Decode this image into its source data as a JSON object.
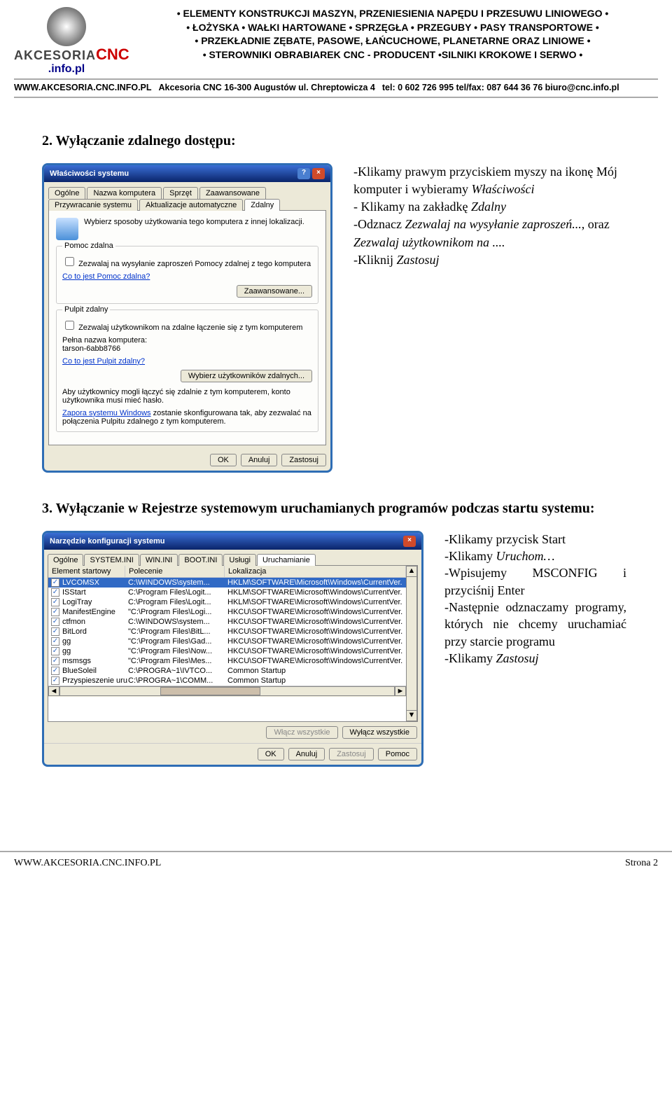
{
  "header": {
    "logo": {
      "akc": "AKCESORIA",
      "cnc": "CNC",
      "info": ".info.pl"
    },
    "lines": [
      "• ELEMENTY KONSTRUKCJI MASZYN, PRZENIESIENIA NAPĘDU I PRZESUWU LINIOWEGO •",
      "• ŁOŻYSKA • WAŁKI HARTOWANE • SPRZĘGŁA • PRZEGUBY • PASY TRANSPORTOWE •",
      "• PRZEKŁADNIE ZĘBATE, PASOWE, ŁAŃCUCHOWE, PLANETARNE ORAZ LINIOWE •",
      "• STEROWNIKI OBRABIAREK CNC - PRODUCENT •SILNIKI KROKOWE I SERWO •"
    ],
    "contact": {
      "url": "WWW.AKCESORIA.CNC.INFO.PL",
      "addr": "Akcesoria CNC  16-300 Augustów   ul. Chreptowicza 4",
      "tel": "tel: 0 602 726 995 tel/fax: 087 644 36 76  biuro@cnc.info.pl"
    }
  },
  "section2": {
    "title": "2. Wyłączanie zdalnego dostępu:",
    "instr": {
      "l1a": "-Klikamy prawym przyciskiem myszy na ikonę Mój komputer i wybieramy ",
      "l1b": "Właściwości",
      "l2a": "- Klikamy na zakładkę ",
      "l2b": "Zdalny",
      "l3a": "-Odznacz ",
      "l3b": "Zezwalaj na wysyłanie zaproszeń...",
      "l3c": ", oraz ",
      "l3d": "Zezwalaj użytkownikom na ....",
      "l4a": "-Kliknij ",
      "l4b": "Zastosuj"
    },
    "dialog": {
      "title": "Właściwości systemu",
      "tabs_row1": [
        "Ogólne",
        "Nazwa komputera",
        "Sprzęt",
        "Zaawansowane"
      ],
      "tabs_row2": [
        "Przywracanie systemu",
        "Aktualizacje automatyczne",
        "Zdalny"
      ],
      "intro": "Wybierz sposoby użytkowania tego komputera z innej lokalizacji.",
      "group1_title": "Pomoc zdalna",
      "chk1": "Zezwalaj na wysyłanie zaproszeń Pomocy zdalnej z tego komputera",
      "link1": "Co to jest Pomoc zdalna?",
      "btn_adv": "Zaawansowane...",
      "group2_title": "Pulpit zdalny",
      "chk2": "Zezwalaj użytkownikom na zdalne łączenie się z tym komputerem",
      "fullname_label": "Pełna nazwa komputera:",
      "fullname_val": "tarson-6abb8766",
      "link2": "Co to jest Pulpit zdalny?",
      "btn_users": "Wybierz użytkowników zdalnych...",
      "note1": "Aby użytkownicy mogli łączyć się zdalnie z tym komputerem, konto użytkownika musi mieć hasło.",
      "note2a": "Zapora systemu Windows",
      "note2b": " zostanie skonfigurowana tak, aby zezwalać na połączenia Pulpitu zdalnego z tym komputerem.",
      "btn_ok": "OK",
      "btn_cancel": "Anuluj",
      "btn_apply": "Zastosuj"
    }
  },
  "section3": {
    "title": "3. Wyłączanie w Rejestrze systemowym uruchamianych programów podczas startu systemu:",
    "instr": {
      "l1": "-Klikamy przycisk Start",
      "l2a": "-Klikamy ",
      "l2b": "Uruchom…",
      "l3": "-Wpisujemy MSCONFIG i przyciśnij Enter",
      "l4": "-Następnie odznaczamy programy, których nie chcemy uruchamiać przy starcie programu",
      "l5a": "-Klikamy ",
      "l5b": "Zastosuj"
    },
    "dialog": {
      "title": "Narzędzie konfiguracji systemu",
      "tabs": [
        "Ogólne",
        "SYSTEM.INI",
        "WIN.INI",
        "BOOT.INI",
        "Usługi",
        "Uruchamianie"
      ],
      "col1": "Element startowy",
      "col2": "Polecenie",
      "col3": "Lokalizacja",
      "rows": [
        {
          "n": "LVCOMSX",
          "c": "C:\\WINDOWS\\system...",
          "l": "HKLM\\SOFTWARE\\Microsoft\\Windows\\CurrentVer."
        },
        {
          "n": "ISStart",
          "c": "C:\\Program Files\\Logit...",
          "l": "HKLM\\SOFTWARE\\Microsoft\\Windows\\CurrentVer."
        },
        {
          "n": "LogiTray",
          "c": "C:\\Program Files\\Logit...",
          "l": "HKLM\\SOFTWARE\\Microsoft\\Windows\\CurrentVer."
        },
        {
          "n": "ManifestEngine",
          "c": "\"C:\\Program Files\\Logi...",
          "l": "HKCU\\SOFTWARE\\Microsoft\\Windows\\CurrentVer."
        },
        {
          "n": "ctfmon",
          "c": "C:\\WINDOWS\\system...",
          "l": "HKCU\\SOFTWARE\\Microsoft\\Windows\\CurrentVer."
        },
        {
          "n": "BitLord",
          "c": "\"C:\\Program Files\\BitL...",
          "l": "HKCU\\SOFTWARE\\Microsoft\\Windows\\CurrentVer."
        },
        {
          "n": "gg",
          "c": "\"C:\\Program Files\\Gad...",
          "l": "HKCU\\SOFTWARE\\Microsoft\\Windows\\CurrentVer."
        },
        {
          "n": "gg",
          "c": "\"C:\\Program Files\\Now...",
          "l": "HKCU\\SOFTWARE\\Microsoft\\Windows\\CurrentVer."
        },
        {
          "n": "msmsgs",
          "c": "\"C:\\Program Files\\Mes...",
          "l": "HKCU\\SOFTWARE\\Microsoft\\Windows\\CurrentVer."
        },
        {
          "n": "BlueSoleil",
          "c": "C:\\PROGRA~1\\IVTCO...",
          "l": "Common Startup"
        },
        {
          "n": "Przyspieszenie uru...",
          "c": "C:\\PROGRA~1\\COMM...",
          "l": "Common Startup"
        }
      ],
      "btn_all_on": "Włącz wszystkie",
      "btn_all_off": "Wyłącz wszystkie",
      "btn_ok": "OK",
      "btn_cancel": "Anuluj",
      "btn_apply": "Zastosuj",
      "btn_help": "Pomoc"
    }
  },
  "footer": {
    "left": "WWW.AKCESORIA.CNC.INFO.PL",
    "right": "Strona 2"
  }
}
